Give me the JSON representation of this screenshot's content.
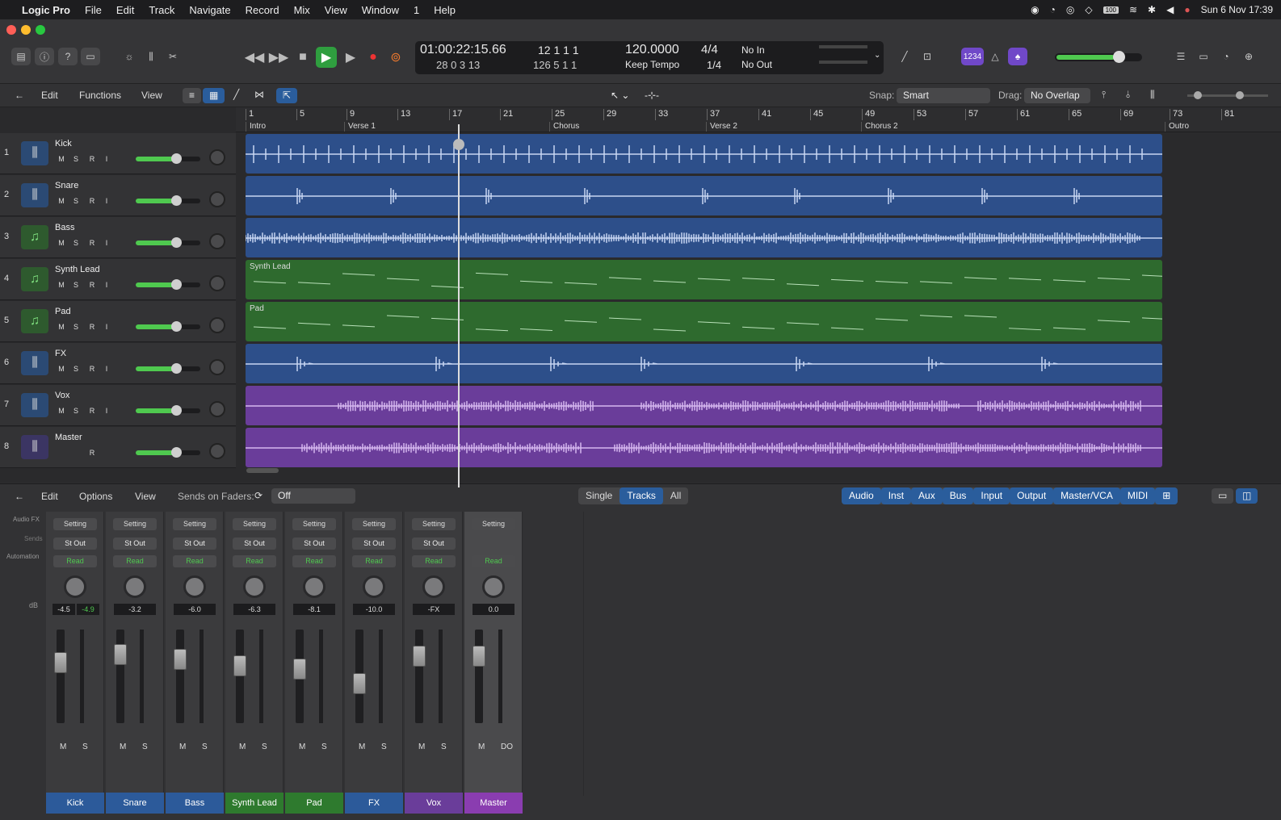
{
  "menubar": {
    "app": "Logic Pro",
    "items": [
      "File",
      "Edit",
      "Track",
      "Navigate",
      "Record",
      "Mix",
      "View",
      "Window",
      "1",
      "Help"
    ],
    "clock": "Sun 6 Nov  17:39",
    "battery": "100"
  },
  "lcd": {
    "time": "01:00:22:15.66",
    "sub_time": "28  0  3  13",
    "bars": "12  1  1    1",
    "bars_sub": "126  5  1    1",
    "tempo": "120.0000",
    "tempo_mode": "Keep Tempo",
    "signature": "4/4",
    "division": "1/4",
    "in": "No In",
    "out": "No Out"
  },
  "toolbar": {
    "edit": "Edit",
    "functions": "Functions",
    "view": "View",
    "snap_label": "Snap:",
    "snap_value": "Smart",
    "drag_label": "Drag:",
    "drag_value": "No Overlap",
    "badge": "1234"
  },
  "ruler": {
    "bars": [
      "1",
      "5",
      "9",
      "13",
      "17",
      "21",
      "25",
      "29",
      "33",
      "37",
      "41",
      "45",
      "49",
      "53",
      "57",
      "61",
      "65",
      "69",
      "73",
      "81"
    ],
    "markers": [
      "Intro",
      "Verse 1",
      "Chorus",
      "Verse 2",
      "Chorus 2",
      "Outro"
    ]
  },
  "tracks": [
    {
      "num": "1",
      "name": "Kick",
      "color": "#2d4f8a",
      "type": "audio"
    },
    {
      "num": "2",
      "name": "Snare",
      "color": "#2d4f8a",
      "type": "audio"
    },
    {
      "num": "3",
      "name": "Bass",
      "color": "#2d4f8a",
      "type": "inst"
    },
    {
      "num": "4",
      "name": "Synth Lead",
      "color": "#2e6a2e",
      "type": "inst",
      "region_label": "Synth Lead"
    },
    {
      "num": "5",
      "name": "Pad",
      "color": "#2e6a2e",
      "type": "inst",
      "region_label": "Pad"
    },
    {
      "num": "6",
      "name": "FX",
      "color": "#2d4f8a",
      "type": "audio"
    },
    {
      "num": "7",
      "name": "Vox",
      "color": "#6a3d9a",
      "type": "audio"
    },
    {
      "num": "8",
      "name": "Master",
      "color": "#6a3d9a",
      "type": "aux"
    }
  ],
  "track_buttons": {
    "m": "M",
    "s": "S",
    "r": "R",
    "i": "I"
  },
  "mixerbar": {
    "edit": "Edit",
    "options": "Options",
    "view": "View",
    "sends_label": "Sends on Faders:",
    "sends_value": "Off",
    "modes": [
      "Single",
      "Tracks",
      "All"
    ],
    "filters": [
      "Audio",
      "Inst",
      "Aux",
      "Bus",
      "Input",
      "Output",
      "Master/VCA",
      "MIDI"
    ]
  },
  "mixer_labels": {
    "audio_fx": "Audio FX",
    "sends": "Sends",
    "automation": "Automation",
    "db": "dB"
  },
  "strips": [
    {
      "name": "Kick",
      "color": "#2c5a9a",
      "setting": "Setting",
      "out": "St Out",
      "auto": "Read",
      "db1": "-4.5",
      "db2": "-4.9",
      "m": "M",
      "s": "S"
    },
    {
      "name": "Snare",
      "color": "#2c5a9a",
      "setting": "Setting",
      "out": "St Out",
      "auto": "Read",
      "db1": "-3.2",
      "db2": "",
      "m": "M",
      "s": "S"
    },
    {
      "name": "Bass",
      "color": "#2c5a9a",
      "setting": "Setting",
      "out": "St Out",
      "auto": "Read",
      "db1": "-6.0",
      "db2": "",
      "m": "M",
      "s": "S"
    },
    {
      "name": "Synth Lead",
      "color": "#2e7a2e",
      "setting": "Setting",
      "out": "St Out",
      "auto": "Read",
      "db1": "-6.3",
      "db2": "",
      "m": "M",
      "s": "S"
    },
    {
      "name": "Pad",
      "color": "#2e7a2e",
      "setting": "Setting",
      "out": "St Out",
      "auto": "Read",
      "db1": "-8.1",
      "db2": "",
      "m": "M",
      "s": "S"
    },
    {
      "name": "FX",
      "color": "#2c5a9a",
      "setting": "Setting",
      "out": "St Out",
      "auto": "Read",
      "db1": "-10.0",
      "db2": "",
      "m": "M",
      "s": "S"
    },
    {
      "name": "Vox",
      "color": "#6a3d9a",
      "setting": "Setting",
      "out": "St Out",
      "auto": "Read",
      "db1": "-FX",
      "db2": "",
      "m": "M",
      "s": "S"
    },
    {
      "name": "Master",
      "color": "#8a3db0",
      "setting": "Setting",
      "out": "",
      "auto": "Read",
      "db1": "0.0",
      "db2": "",
      "m": "M",
      "s": "DO"
    }
  ]
}
